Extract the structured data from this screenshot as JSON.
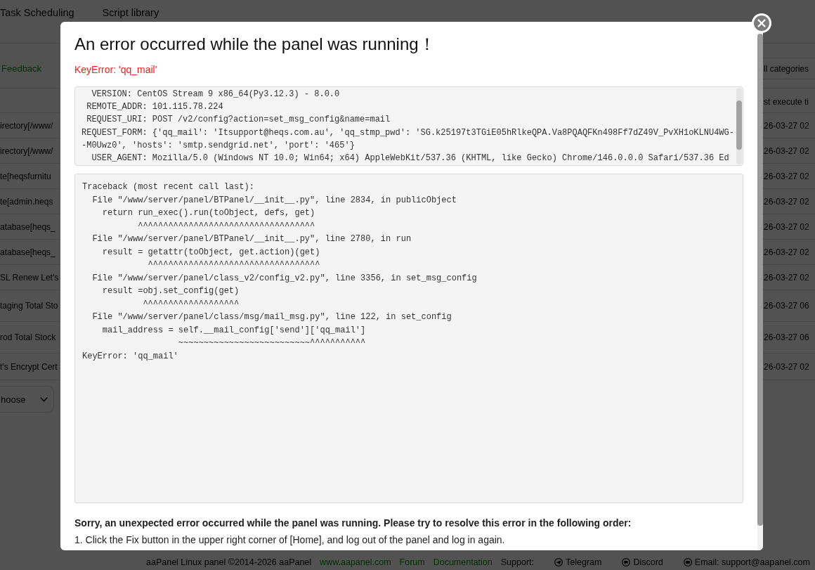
{
  "page": {
    "tabs": [
      "Task Scheduling",
      "Script library"
    ],
    "feedback_link": "Feedback",
    "category_select": "ll categories",
    "table": {
      "header": {
        "column_2": "st execute ti"
      },
      "rows": [
        {
          "column_1": "irectory[/www/",
          "column_2": "26-03-27 02"
        },
        {
          "column_1": "irectory[/www/",
          "column_2": "26-03-27 02"
        },
        {
          "column_1": "te[heqsfurnitu",
          "column_2": "26-03-27 02"
        },
        {
          "column_1": "te[admin.heqs",
          "column_2": "26-03-27 02"
        },
        {
          "column_1": "atabase[heqs_",
          "column_2": "26-03-27 02"
        },
        {
          "column_1": "atabase[heqs_",
          "column_2": "26-03-27 02"
        },
        {
          "column_1": "SL Renew Let's",
          "column_2": "26-03-27 02"
        },
        {
          "column_1": "taging Total Sto",
          "column_2": "26-03-27 06"
        },
        {
          "column_1": "rod Total Stock",
          "column_2": "26-03-27 06"
        },
        {
          "column_1": "t's Encrypt Cert",
          "column_2": "26-03-27 02"
        }
      ]
    },
    "page_select": "hoose",
    "footer": {
      "copyright": "aaPanel Linux panel ©2014-2026 aaPanel",
      "links": [
        "www.aapanel.com",
        "Forum",
        "Documentation"
      ],
      "support_label": "Support:",
      "support_links": [
        {
          "kind": "plane",
          "label": "Telegram"
        },
        {
          "kind": "chat",
          "label": "Discord"
        },
        {
          "kind": "mail",
          "label": "Email: support@aapanel.com"
        }
      ]
    }
  },
  "dialog": {
    "title": "An error occurred while the panel was running！",
    "error": "KeyError: 'qq_mail'",
    "request_info": [
      "  VERSION: CentOS Stream 9 x86_64(Py3.12.3) - 8.0.0",
      " REMOTE_ADDR: 101.115.78.224",
      " REQUEST_URI: POST /v2/config?action=set_msg_config&name=mail",
      "REQUEST_FORM: {'qq_mail': 'Itsupport@heqs.com.au', 'qq_stmp_pwd': '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', 'hosts': 'smtp.sendgrid.net', 'port': '465'}",
      "  USER_AGENT: Mozilla/5.0 (Windows NT 10.0; Win64; x64) AppleWebKit/537.36 (KHTML, like Gecko) Chrome/146.0.0.0 Safari/537.36 Ed"
    ],
    "traceback": "Traceback (most recent call last):\n  File \"/www/server/panel/BTPanel/__init__.py\", line 2834, in publicObject\n    return run_exec().run(toObject, defs, get)\n           ^^^^^^^^^^^^^^^^^^^^^^^^^^^^^^^^^^^\n  File \"/www/server/panel/BTPanel/__init__.py\", line 2780, in run\n    result = getattr(toObject, get.action)(get)\n             ^^^^^^^^^^^^^^^^^^^^^^^^^^^^^^^^^^\n  File \"/www/server/panel/class_v2/config_v2.py\", line 3356, in set_msg_config\n    result =obj.set_config(get)\n            ^^^^^^^^^^^^^^^^^^^\n  File \"/www/server/panel/class/msg/mail_msg.py\", line 122, in set_config\n    mail_address = self.__mail_config['send']['qq_mail']\n                   ~~~~~~~~~~~~~~~~~~~~~~~~~~^^^^^^^^^^^\nKeyError: 'qq_mail'",
    "message": "Sorry, an unexpected error occurred while the panel was running. Please try to resolve this error in the following order:",
    "steps": [
      "1. Click the Fix button in the upper right corner of [Home], and log out of the panel and log in again."
    ]
  }
}
